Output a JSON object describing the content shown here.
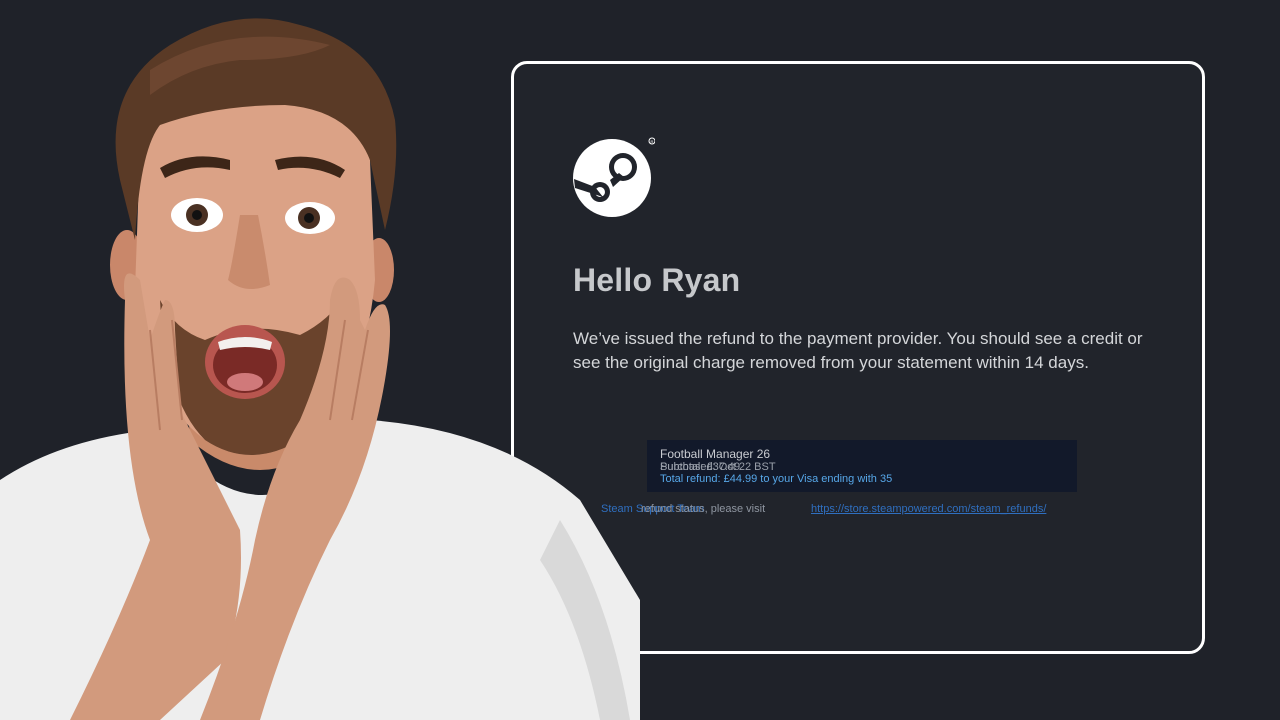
{
  "email": {
    "greeting": "Hello Ryan",
    "message": "We’ve issued the refund to the payment provider. You should see a credit or see the original charge removed from your statement within 14 days.",
    "refund_panel": {
      "game_title": "Football Manager 26",
      "purchased": "Purchased: Oct 22 BST",
      "subtotal": "Subtotal: £37.49",
      "total_refund_label": "Total refund:",
      "total_refund_value": "£44.99 to your Visa ending with 35"
    },
    "footer": {
      "prefix_link": "Steam Support Team",
      "text": "refund status, please visit",
      "url": "https://store.steampowered.com/steam_refunds/"
    }
  },
  "colors": {
    "background": "#1f2229",
    "card_border": "#ffffff",
    "link_blue": "#57a7e8",
    "panel_bg": "#12192a"
  },
  "icons": {
    "logo": "steam-logo-icon"
  }
}
